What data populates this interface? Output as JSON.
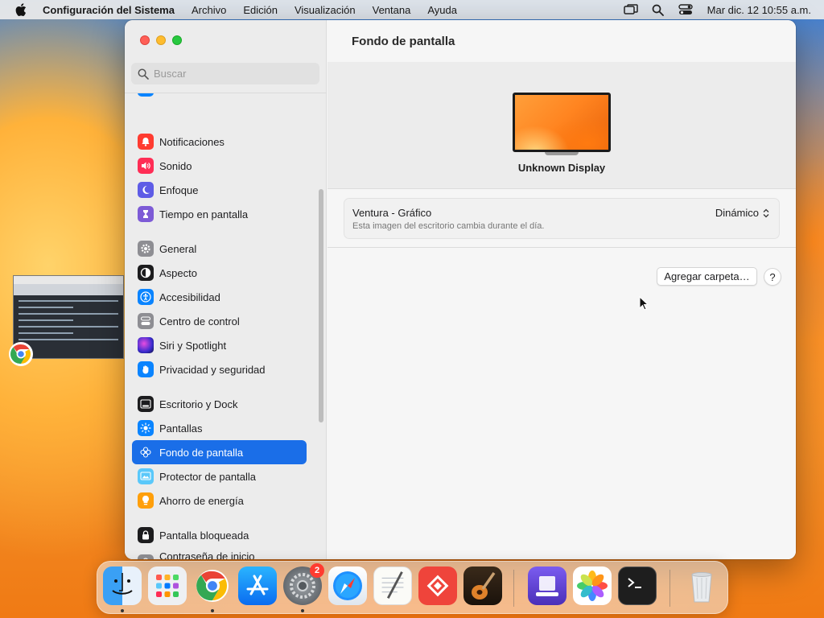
{
  "menubar": {
    "app_name": "Configuración del Sistema",
    "menus": [
      "Archivo",
      "Edición",
      "Visualización",
      "Ventana",
      "Ayuda"
    ],
    "clock": "Mar dic. 12  10:55 a.m."
  },
  "search": {
    "placeholder": "Buscar"
  },
  "sidebar": {
    "items": [
      {
        "label": "Notificaciones",
        "icon": "bell-icon",
        "color": "#ff3b30"
      },
      {
        "label": "Sonido",
        "icon": "speaker-icon",
        "color": "#ff2d55"
      },
      {
        "label": "Enfoque",
        "icon": "moon-icon",
        "color": "#5e5ce6"
      },
      {
        "label": "Tiempo en pantalla",
        "icon": "hourglass-icon",
        "color": "#7d5bd6"
      },
      {
        "label": "General",
        "icon": "gear-icon",
        "color": "#8e8e93"
      },
      {
        "label": "Aspecto",
        "icon": "appearance-icon",
        "color": "#1c1c1e"
      },
      {
        "label": "Accesibilidad",
        "icon": "accessibility-icon",
        "color": "#0a84ff"
      },
      {
        "label": "Centro de control",
        "icon": "control-center-icon",
        "color": "#8e8e93"
      },
      {
        "label": "Siri y Spotlight",
        "icon": "siri-icon",
        "color": "#5a3fd6"
      },
      {
        "label": "Privacidad y seguridad",
        "icon": "hand-icon",
        "color": "#0a84ff"
      },
      {
        "label": "Escritorio y Dock",
        "icon": "dock-icon",
        "color": "#1c1c1e"
      },
      {
        "label": "Pantallas",
        "icon": "sun-icon",
        "color": "#0a84ff"
      },
      {
        "label": "Fondo de pantalla",
        "icon": "flower-icon",
        "color": "#34aadc",
        "selected": true
      },
      {
        "label": "Protector de pantalla",
        "icon": "screensaver-icon",
        "color": "#5ac8fa"
      },
      {
        "label": "Ahorro de energía",
        "icon": "bulb-icon",
        "color": "#ff9f0a"
      },
      {
        "label": "Pantalla bloqueada",
        "icon": "lock-icon",
        "color": "#1c1c1e"
      },
      {
        "label": "Contraseña de inicio de sesión",
        "icon": "password-lock-icon",
        "color": "#8e8e93"
      }
    ]
  },
  "main": {
    "title": "Fondo de pantalla",
    "display_name": "Unknown Display",
    "wallpaper": {
      "name": "Ventura - Gráfico",
      "description": "Esta imagen del escritorio cambia durante el día.",
      "mode": "Dinámico"
    },
    "add_folder_label": "Agregar carpeta…",
    "help_label": "?"
  },
  "dock": {
    "apps": [
      {
        "name": "finder-icon",
        "running": true
      },
      {
        "name": "launchpad-icon",
        "running": false
      },
      {
        "name": "chrome-icon",
        "running": true
      },
      {
        "name": "app-store-icon",
        "running": false
      },
      {
        "name": "system-settings-icon",
        "running": true,
        "badge": "2"
      },
      {
        "name": "safari-icon",
        "running": false
      },
      {
        "name": "textedit-icon",
        "running": false
      },
      {
        "name": "anydesk-icon",
        "running": false
      },
      {
        "name": "garageband-icon",
        "running": false
      },
      {
        "name": "apple-configurator-icon",
        "running": false
      },
      {
        "name": "photos-icon",
        "running": false
      },
      {
        "name": "terminal-icon",
        "running": false
      },
      {
        "name": "trash-icon",
        "running": false
      }
    ]
  }
}
